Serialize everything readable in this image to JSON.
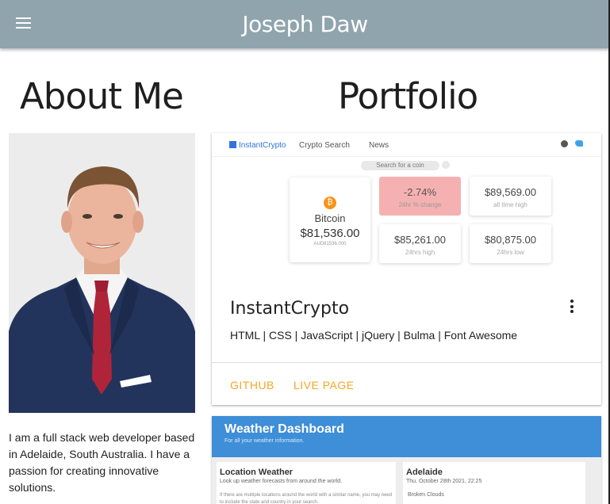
{
  "app": {
    "title": "Joseph Daw"
  },
  "about": {
    "heading": "About Me",
    "bio": "I am a full stack web developer based in Adelaide, South Australia. I have a passion for creating innovative solutions."
  },
  "portfolio": {
    "heading": "Portfolio",
    "projects": [
      {
        "preview": {
          "brand": "InstantCrypto",
          "nav_search": "Crypto Search",
          "nav_news": "News",
          "search_placeholder": "Search for a coin",
          "coin_name": "Bitcoin",
          "coin_price": "$81,536.00",
          "coin_sub": "AUD81536.000",
          "change_value": "-2.74%",
          "change_label": "24hr % change",
          "ath_value": "$89,569.00",
          "ath_label": "all time high",
          "high_value": "$85,261.00",
          "high_label": "24hrs high",
          "low_value": "$80,875.00",
          "low_label": "24hrs low"
        },
        "title": "InstantCrypto",
        "tech": "HTML | CSS | JavaScript | jQuery | Bulma | Font Awesome",
        "links": {
          "github": "GITHUB",
          "live": "LIVE PAGE"
        }
      },
      {
        "preview": {
          "title": "Weather Dashboard",
          "subtitle": "For all your weather information.",
          "left_heading": "Location Weather",
          "left_sub": "Look up weather forecasts from around the world.",
          "left_text": "If there are multiple locations around the world with a similar name, you may need to include the state and country in your search.",
          "right_heading": "Adelaide",
          "right_date": "Thu, October 28th 2021, 22:25",
          "right_cond": "Broken Clouds"
        }
      }
    ]
  },
  "colors": {
    "appbar": "#90a4ae",
    "link": "#f5a623",
    "weather_header": "#3e8ed8",
    "crypto_change": "#f5b1b1"
  }
}
